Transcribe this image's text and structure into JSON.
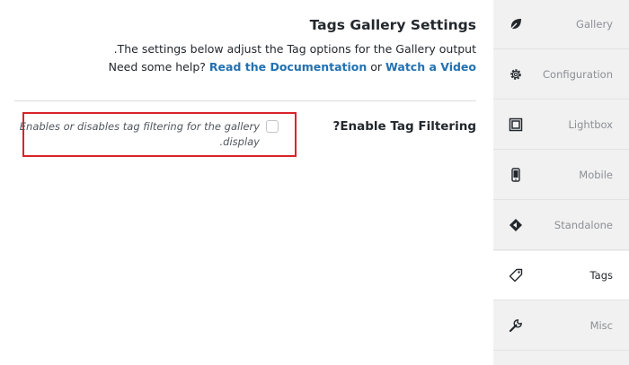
{
  "header": {
    "title": "Tags Gallery Settings",
    "description": "The settings below adjust the Tag options for the Gallery output.",
    "help_prefix": "Need some help?",
    "docs_link": "Read the Documentation",
    "or_text": "or",
    "video_link": "Watch a Video"
  },
  "field": {
    "label": "Enable Tag Filtering?",
    "checked": false,
    "help_line1": "Enables or disables tag filtering for the gallery",
    "help_line2": "display."
  },
  "sidebar": {
    "items": [
      {
        "label": "Gallery",
        "icon": "leaf-icon"
      },
      {
        "label": "Configuration",
        "icon": "gear-icon"
      },
      {
        "label": "Lightbox",
        "icon": "lightbox-icon"
      },
      {
        "label": "Mobile",
        "icon": "mobile-icon"
      },
      {
        "label": "Standalone",
        "icon": "standalone-icon"
      },
      {
        "label": "Tags",
        "icon": "tag-icon"
      },
      {
        "label": "Misc",
        "icon": "wrench-icon"
      }
    ],
    "active": "Tags"
  },
  "colors": {
    "link": "#2271b1",
    "highlight_border": "#d9232a",
    "sidebar_bg": "#f1f1f1"
  }
}
